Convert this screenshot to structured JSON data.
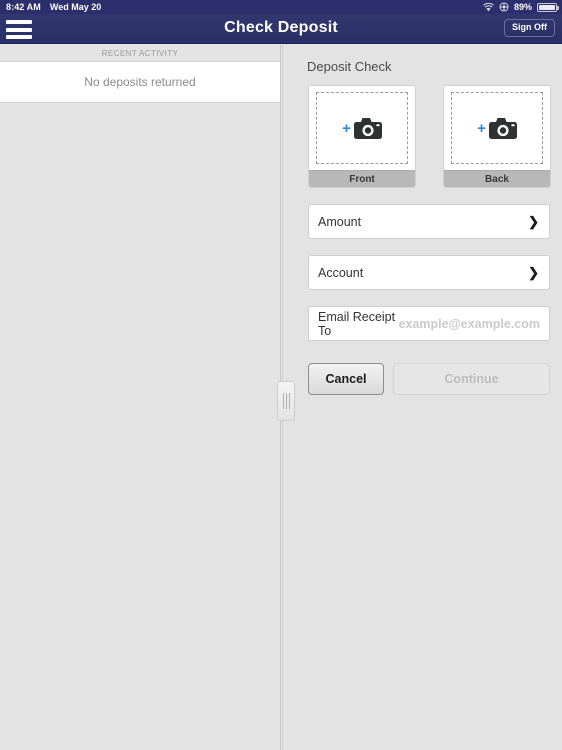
{
  "status_bar": {
    "time": "8:42 AM",
    "date": "Wed May 20",
    "battery_percent": "89%",
    "wifi_icon": "wifi-icon",
    "location_icon": "location-icon",
    "battery_icon": "battery-icon"
  },
  "nav": {
    "menu_icon": "hamburger-menu-icon",
    "title": "Check Deposit",
    "sign_off_label": "Sign Off"
  },
  "left_pane": {
    "section_header": "RECENT ACTIVITY",
    "empty_message": "No deposits returned"
  },
  "right_pane": {
    "title": "Deposit Check",
    "captures": [
      {
        "label": "Front",
        "icon": "camera-icon",
        "add_icon": "plus-icon"
      },
      {
        "label": "Back",
        "icon": "camera-icon",
        "add_icon": "plus-icon"
      }
    ],
    "fields": [
      {
        "label": "Amount",
        "value": "",
        "accessory": "chevron-right-icon"
      },
      {
        "label": "Account",
        "value": "",
        "accessory": "chevron-right-icon"
      }
    ],
    "email_field": {
      "label": "Email Receipt To",
      "value": "",
      "placeholder": "example@example.com"
    },
    "buttons": {
      "cancel_label": "Cancel",
      "continue_label": "Continue"
    }
  },
  "splitter": {
    "name": "pane-resize-handle"
  },
  "colors": {
    "nav_navy": "#2a2e66",
    "accent_blue": "#2f86d8",
    "page_gray": "#e3e3e3",
    "capture_label_gray": "#b8b8b8"
  }
}
